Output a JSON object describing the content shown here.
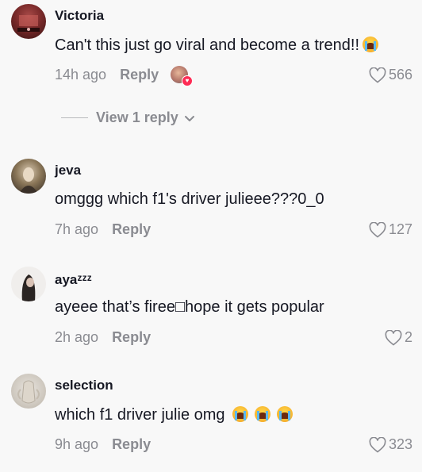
{
  "comments": [
    {
      "username": "Victoria",
      "text": "Can't this just go viral and become a trend!!",
      "time": "14h ago",
      "reply_label": "Reply",
      "likes": "566"
    },
    {
      "username": "jeva",
      "text": "omggg which f1's driver julieee???0_0",
      "time": "7h ago",
      "reply_label": "Reply",
      "likes": "127"
    },
    {
      "username": "ayaᶻᶻᶻ",
      "text": "ayeee that’s firee□hope it gets popular",
      "time": "2h ago",
      "reply_label": "Reply",
      "likes": "2"
    },
    {
      "username": "selection",
      "text": "which f1 driver julie omg",
      "time": "9h ago",
      "reply_label": "Reply",
      "likes": "323"
    }
  ],
  "view_replies": {
    "label": "View 1 reply"
  },
  "icons": {
    "like": "heart-outline-icon",
    "expand": "chevron-down-icon",
    "emoji": "loudly-crying-face-emoji"
  },
  "colors": {
    "like_badge": "#fe2c55",
    "muted": "#8a8b91"
  }
}
